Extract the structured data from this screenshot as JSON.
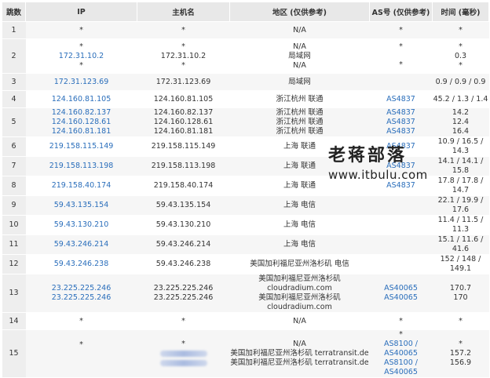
{
  "headers": {
    "hop": "跳数",
    "ip": "IP",
    "host": "主机名",
    "region": "地区 (仅供参考)",
    "as": "AS号 (仅供参考)",
    "time": "时间 (毫秒)"
  },
  "watermark": {
    "line1": "老蒋部落",
    "line2": "www.itbulu.com"
  },
  "rows": [
    {
      "hop": "1",
      "ip": [
        "*"
      ],
      "host": [
        "*"
      ],
      "region": [
        "N/A"
      ],
      "as": [
        "*"
      ],
      "time": [
        "*"
      ]
    },
    {
      "hop": "2",
      "ip": [
        "*",
        "172.31.10.2",
        "*"
      ],
      "host": [
        "*",
        "172.31.10.2",
        "*"
      ],
      "region": [
        "N/A",
        "局域网",
        "N/A"
      ],
      "as": [
        "*",
        "",
        "*"
      ],
      "time": [
        "*",
        "0.3",
        "*"
      ]
    },
    {
      "hop": "3",
      "ip": [
        "172.31.123.69"
      ],
      "host": [
        "172.31.123.69"
      ],
      "region": [
        "局域网"
      ],
      "as": [
        ""
      ],
      "time": [
        "0.9 / 0.9 / 0.9"
      ]
    },
    {
      "hop": "4",
      "ip": [
        "124.160.81.105"
      ],
      "host": [
        "124.160.81.105"
      ],
      "region": [
        "浙江杭州 联通"
      ],
      "as": [
        "AS4837"
      ],
      "time": [
        "45.2 / 1.3 / 1.4"
      ]
    },
    {
      "hop": "5",
      "ip": [
        "124.160.82.137",
        "124.160.128.61",
        "124.160.81.181"
      ],
      "host": [
        "124.160.82.137",
        "124.160.128.61",
        "124.160.81.181"
      ],
      "region": [
        "浙江杭州 联通",
        "浙江杭州 联通",
        "浙江杭州 联通"
      ],
      "as": [
        "AS4837",
        "AS4837",
        "AS4837"
      ],
      "time": [
        "14.2",
        "12.4",
        "16.4"
      ]
    },
    {
      "hop": "6",
      "ip": [
        "219.158.115.149"
      ],
      "host": [
        "219.158.115.149"
      ],
      "region": [
        "上海 联通"
      ],
      "as": [
        "AS4837"
      ],
      "time": [
        "10.9 / 16.5 / 14.3"
      ]
    },
    {
      "hop": "7",
      "ip": [
        "219.158.113.198"
      ],
      "host": [
        "219.158.113.198"
      ],
      "region": [
        "上海 联通"
      ],
      "as": [
        "AS4837"
      ],
      "time": [
        "14.1 / 14.1 / 15.8"
      ]
    },
    {
      "hop": "8",
      "ip": [
        "219.158.40.174"
      ],
      "host": [
        "219.158.40.174"
      ],
      "region": [
        "上海 联通"
      ],
      "as": [
        "AS4837"
      ],
      "time": [
        "17.8 / 17.8 / 14.7"
      ]
    },
    {
      "hop": "9",
      "ip": [
        "59.43.135.154"
      ],
      "host": [
        "59.43.135.154"
      ],
      "region": [
        "上海 电信"
      ],
      "as": [
        ""
      ],
      "time": [
        "22.1 / 19.9 / 17.6"
      ]
    },
    {
      "hop": "10",
      "ip": [
        "59.43.130.210"
      ],
      "host": [
        "59.43.130.210"
      ],
      "region": [
        "上海 电信"
      ],
      "as": [
        ""
      ],
      "time": [
        "11.4 / 11.5 / 11.3"
      ]
    },
    {
      "hop": "11",
      "ip": [
        "59.43.246.214"
      ],
      "host": [
        "59.43.246.214"
      ],
      "region": [
        "上海 电信"
      ],
      "as": [
        ""
      ],
      "time": [
        "15.1 / 11.6 / 41.6"
      ]
    },
    {
      "hop": "12",
      "ip": [
        "59.43.246.238"
      ],
      "host": [
        "59.43.246.238"
      ],
      "region": [
        "美国加利福尼亚州洛杉矶 电信"
      ],
      "as": [
        ""
      ],
      "time": [
        "152 / 148 / 149.1"
      ]
    },
    {
      "hop": "13",
      "ip": [
        "23.225.225.246",
        "23.225.225.246"
      ],
      "host": [
        "23.225.225.246",
        "23.225.225.246"
      ],
      "region": [
        "美国加利福尼亚州洛杉矶 cloudradium.com",
        "美国加利福尼亚州洛杉矶 cloudradium.com"
      ],
      "as": [
        "AS40065",
        "AS40065"
      ],
      "time": [
        "170.7",
        "170"
      ]
    },
    {
      "hop": "14",
      "ip": [
        "*"
      ],
      "host": [
        "*"
      ],
      "region": [
        "N/A"
      ],
      "as": [
        "*"
      ],
      "time": [
        "*"
      ]
    },
    {
      "hop": "15",
      "ip": [
        "*",
        "",
        ""
      ],
      "host": [
        "*",
        "",
        ""
      ],
      "region": [
        "N/A",
        "美国加利福尼亚州洛杉矶 terratransit.de",
        "美国加利福尼亚州洛杉矶 terratransit.de"
      ],
      "as": [
        "*",
        "AS8100 / AS40065",
        "AS8100 / AS40065"
      ],
      "time": [
        "*",
        "157.2",
        "156.9"
      ]
    }
  ]
}
